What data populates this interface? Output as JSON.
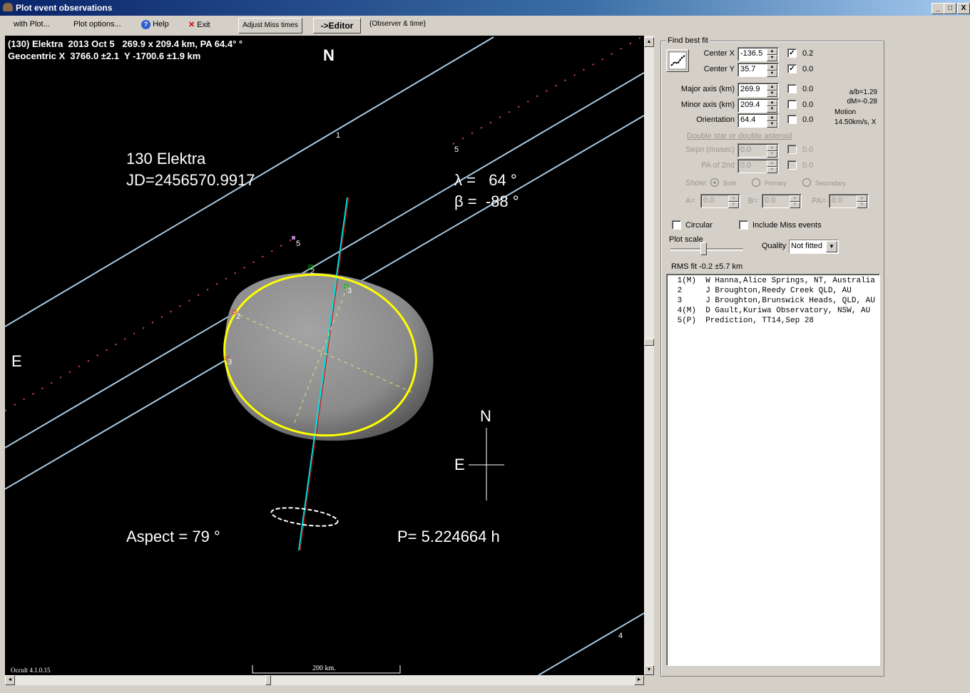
{
  "window": {
    "title": "Plot event observations",
    "minimize_glyph": "_",
    "maximize_glyph": "□",
    "close_glyph": "X"
  },
  "menu": {
    "with_plot": "with Plot...",
    "plot_options": "Plot options...",
    "help": "Help",
    "help_icon": "?",
    "exit": "Exit",
    "exit_icon": "✕",
    "adjust_miss_times": "Adjust Miss times",
    "editor": "->Editor",
    "observer_time": "{Observer & time}"
  },
  "plot": {
    "header_line1": "(130) Elektra  2013 Oct 5   269.9 x 209.4 km, PA 64.4° °",
    "header_line2": "Geocentric X  3766.0 ±2.1  Y -1700.6 ±1.9 km",
    "north_label": "N",
    "east_label": "E",
    "asteroid_name": "130 Elektra",
    "jd": "JD=2456570.9917",
    "lambda": "λ =   64 °",
    "beta": "β =  -88 °",
    "aspect": "Aspect = 79 °",
    "period": "P= 5.224664 h",
    "compass_n": "N",
    "compass_e": "E",
    "version": "Occult 4.1.0.15",
    "scale_label": "200 km.",
    "chord_labels": [
      "1",
      "2",
      "3",
      "2",
      "3",
      "4",
      "5",
      "5"
    ],
    "colors": {
      "chord": "#a8c8e0",
      "prediction": "#e0407a",
      "fit_ellipse": "#ffff00",
      "shape_model": "#8a8a8a",
      "background": "#000000"
    }
  },
  "fit": {
    "group_title": "Find best fit",
    "center_x": {
      "label": "Center X",
      "value": "-136.5",
      "checked": true,
      "delta": "0.2"
    },
    "center_y": {
      "label": "Center Y",
      "value": "35.7",
      "checked": true,
      "delta": "0.0"
    },
    "major_axis": {
      "label": "Major axis (km)",
      "value": "269.9",
      "checked": false,
      "delta": "0.0"
    },
    "minor_axis": {
      "label": "Minor axis (km)",
      "value": "209.4",
      "checked": false,
      "delta": "0.0"
    },
    "orientation": {
      "label": "Orientation",
      "value": "64.4",
      "checked": false,
      "delta": "0.0"
    },
    "ab_ratio": "a/b=1.29",
    "dm": "dM=-0.28",
    "motion_label": "Motion",
    "motion_value": "14.50km/s, X",
    "double_star_link": "Double star  or  double asteroid",
    "sepn": {
      "label": "Sepn (masec)",
      "value": "0.0",
      "delta": "0.0"
    },
    "pa2": {
      "label": "PA of 2nd",
      "value": "0.0",
      "delta": "0.0"
    },
    "show_label": "Show:",
    "show_options": [
      "Both",
      "Primary",
      "Secondary"
    ],
    "show_selected": "Both",
    "a_label": "A=",
    "a_value": "0.0",
    "b_label": "B=",
    "b_value": "0.0",
    "pa_label": "PA=",
    "pa_value": "0.0",
    "circular": {
      "label": "Circular",
      "checked": false
    },
    "include_miss": {
      "label": "Include Miss events",
      "checked": false
    },
    "plot_scale_label": "Plot scale",
    "plot_scale_fraction": 0.4,
    "quality_label": "Quality",
    "quality_value": "Not fitted",
    "rms": "RMS fit -0.2 ±5.7 km"
  },
  "observers": [
    " 1(M)  W Hanna,Alice Springs, NT, Australia",
    " 2     J Broughton,Reedy Creek QLD, AU",
    " 3     J Broughton,Brunswick Heads, QLD, AU",
    " 4(M)  D Gault,Kuriwa Observatory, NSW, AU",
    " 5(P)  Prediction, TT14,Sep 28"
  ]
}
